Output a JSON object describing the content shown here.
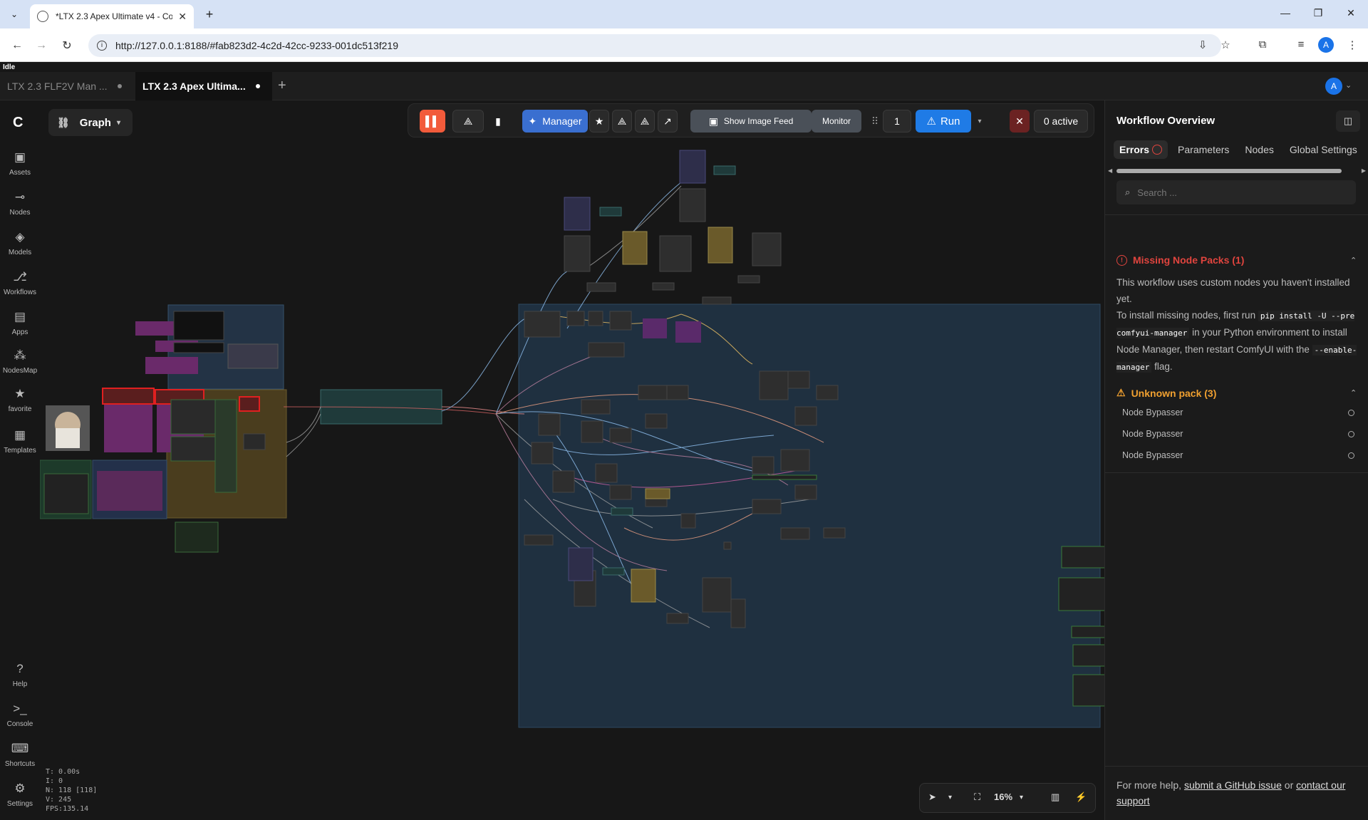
{
  "browser": {
    "tab_title": "*LTX 2.3 Apex Ultimate v4 - Co",
    "url": "http://127.0.0.1:8188/#fab823d2-4c2d-42cc-9233-001dc513f219",
    "profile_initial": "A"
  },
  "app": {
    "status": "Idle",
    "workflow_tabs": [
      {
        "label": "LTX 2.3 FLF2V Man ...",
        "active": false
      },
      {
        "label": "LTX 2.3 Apex Ultima...",
        "active": true
      }
    ],
    "user_initial": "A"
  },
  "sidebar": {
    "items": [
      {
        "label": "Assets",
        "icon": "image-icon"
      },
      {
        "label": "Nodes",
        "icon": "node-icon"
      },
      {
        "label": "Models",
        "icon": "models-icon"
      },
      {
        "label": "Workflows",
        "icon": "workflow-icon"
      },
      {
        "label": "Apps",
        "icon": "apps-icon"
      },
      {
        "label": "NodesMap",
        "icon": "nodesmap-icon"
      },
      {
        "label": "favorite",
        "icon": "star-icon"
      },
      {
        "label": "Templates",
        "icon": "templates-icon"
      }
    ],
    "bottom_items": [
      {
        "label": "Help",
        "icon": "help-icon"
      },
      {
        "label": "Console",
        "icon": "console-icon"
      },
      {
        "label": "Shortcuts",
        "icon": "keyboard-icon"
      },
      {
        "label": "Settings",
        "icon": "gear-icon"
      }
    ]
  },
  "canvas": {
    "mode_label": "Graph",
    "stats": {
      "t": "T: 0.00s",
      "i": "I: 0",
      "n": "N: 118 [118]",
      "v": "V: 245",
      "fps": "FPS:135.14"
    },
    "zoom": "16%"
  },
  "toolbar": {
    "manager_label": "Manager",
    "image_feed_label": "Show Image Feed",
    "monitor_label": "Monitor",
    "queue_count": "1",
    "run_label": "Run",
    "active_label": "0 active"
  },
  "panel": {
    "title": "Workflow Overview",
    "tabs": [
      "Errors",
      "Parameters",
      "Nodes",
      "Global Settings"
    ],
    "search_placeholder": "Search ...",
    "missing": {
      "title": "Missing Node Packs (1)",
      "text1": "This workflow uses custom nodes you haven't installed yet.",
      "text2_a": "To install missing nodes, first run",
      "code1": "pip install -U --pre comfyui-manager",
      "text2_b": "in your Python environment to install Node Manager, then restart ComfyUI with the",
      "code2": "--enable-manager",
      "text2_c": "flag."
    },
    "unknown": {
      "title": "Unknown pack (3)",
      "items": [
        "Node Bypasser",
        "Node Bypasser",
        "Node Bypasser"
      ]
    },
    "footer": {
      "prefix": "For more help,",
      "link1": "submit a GitHub issue",
      "mid": "or",
      "link2": "contact our support"
    }
  },
  "colors": {
    "run": "#1f7be6",
    "manager": "#3a6fd0",
    "error": "#e0443e",
    "warning": "#f0a030",
    "accent_orange": "#f25b3b"
  }
}
